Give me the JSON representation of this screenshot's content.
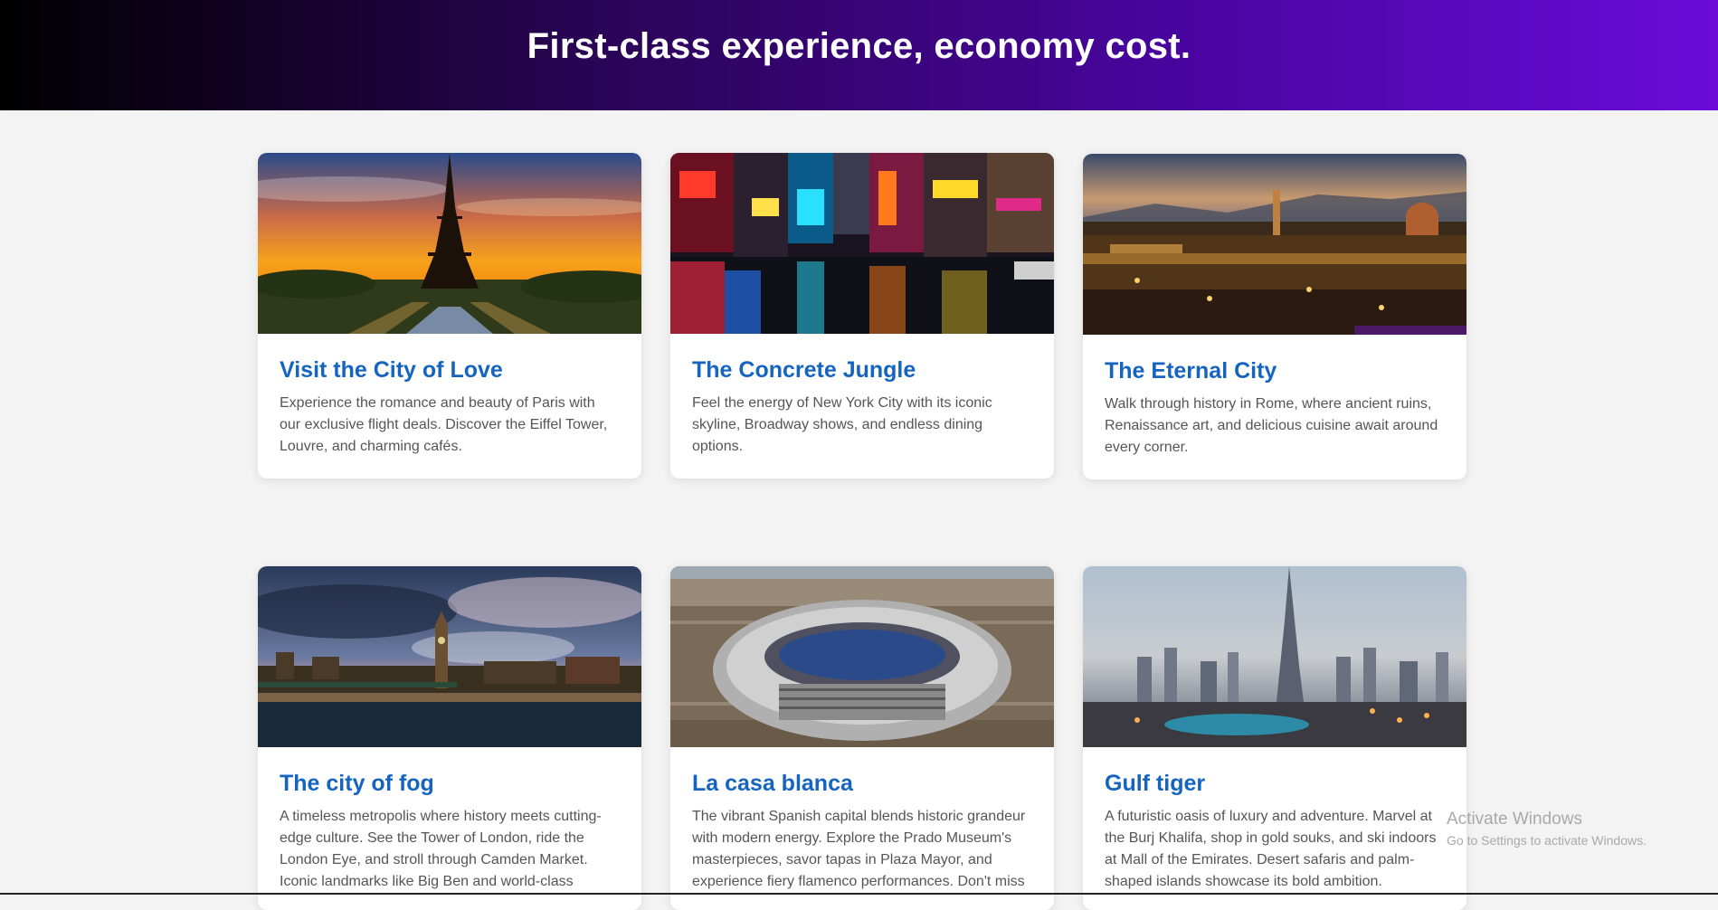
{
  "header": {
    "title": "First-class experience, economy cost."
  },
  "cards": [
    {
      "title": "Visit the City of Love",
      "description": "Experience the romance and beauty of Paris with our exclusive flight deals. Discover the Eiffel Tower, Louvre, and charming cafés."
    },
    {
      "title": "The Concrete Jungle",
      "description": "Feel the energy of New York City with its iconic skyline, Broadway shows, and endless dining options."
    },
    {
      "title": "The Eternal City",
      "description": "Walk through history in Rome, where ancient ruins, Renaissance art, and delicious cuisine await around every corner."
    },
    {
      "title": "The city of fog",
      "description": "A timeless metropolis where history meets cutting-edge culture. See the Tower of London, ride the London Eye, and stroll through Camden Market. Iconic landmarks like Big Ben and world-class"
    },
    {
      "title": "La casa blanca",
      "description": "The vibrant Spanish capital blends historic grandeur with modern energy. Explore the Prado Museum's masterpieces, savor tapas in Plaza Mayor, and experience fiery flamenco performances. Don't miss"
    },
    {
      "title": "Gulf tiger",
      "description": "A futuristic oasis of luxury and adventure. Marvel at the Burj Khalifa, shop in gold souks, and ski indoors at Mall of the Emirates. Desert safaris and palm-shaped islands showcase its bold ambition."
    }
  ],
  "os_watermark": {
    "line1": "Activate Windows",
    "line2": "Go to Settings to activate Windows."
  },
  "colors": {
    "header_gradient_start": "#000000",
    "header_gradient_end": "#6a0bd8",
    "card_title": "#1565c0",
    "card_text": "#555555",
    "page_background": "#f3f3f3"
  }
}
